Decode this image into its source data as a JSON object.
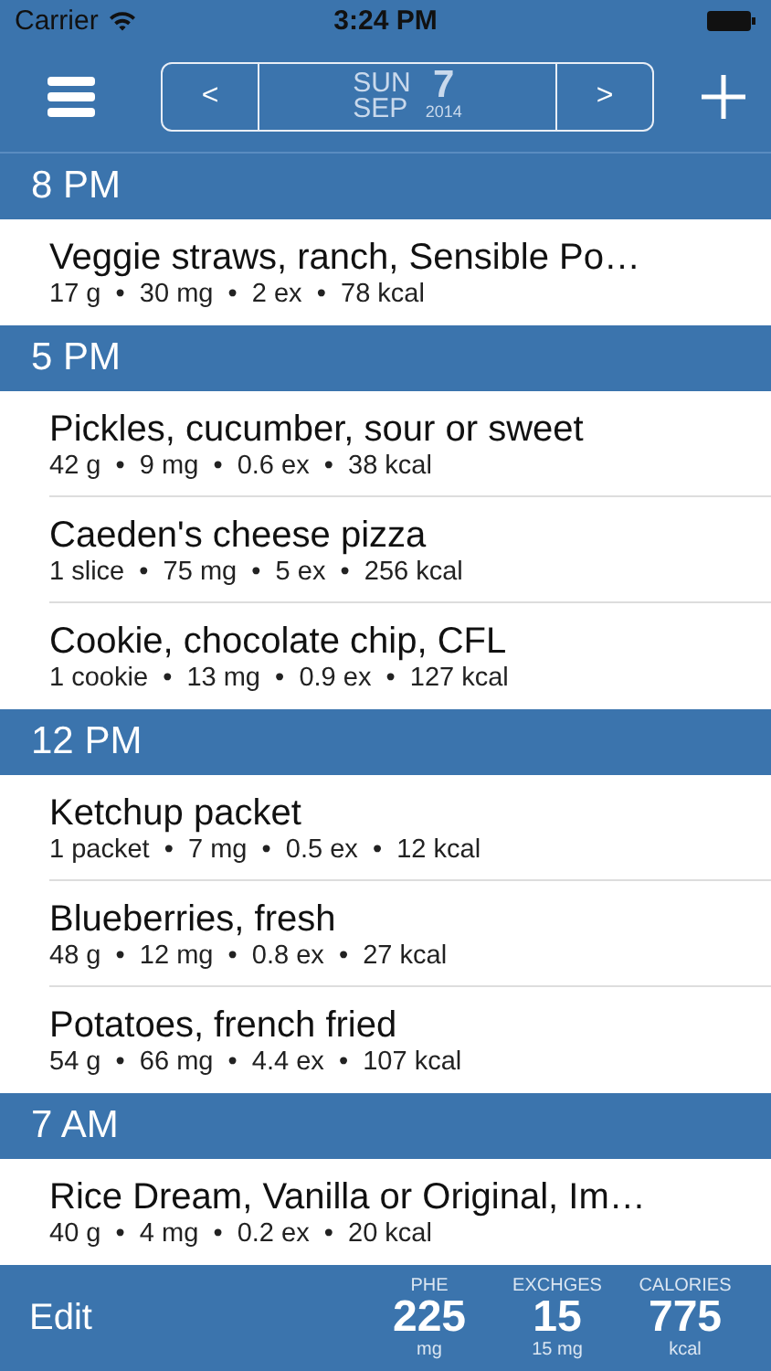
{
  "status_bar": {
    "carrier": "Carrier",
    "time": "3:24 PM"
  },
  "nav": {
    "prev": "<",
    "next": ">",
    "weekday": "SUN",
    "month": "SEP",
    "day": "7",
    "year": "2014"
  },
  "sections": [
    {
      "time": "8 PM",
      "items": [
        {
          "name": "Veggie straws, ranch, Sensible Po…",
          "details": "17 g  •  30 mg  •  2 ex  •  78 kcal"
        }
      ]
    },
    {
      "time": "5 PM",
      "items": [
        {
          "name": "Pickles, cucumber, sour or sweet",
          "details": "42 g  •  9 mg  •  0.6 ex  •  38 kcal"
        },
        {
          "name": "Caeden's cheese pizza",
          "details": "1 slice  •  75 mg  •  5 ex  •  256 kcal"
        },
        {
          "name": "Cookie, chocolate chip, CFL",
          "details": "1 cookie  •  13 mg  •  0.9 ex  •  127 kcal"
        }
      ]
    },
    {
      "time": "12 PM",
      "items": [
        {
          "name": "Ketchup packet",
          "details": "1 packet  •  7 mg  •  0.5 ex  •  12 kcal"
        },
        {
          "name": "Blueberries, fresh",
          "details": "48 g  •  12 mg  •  0.8 ex  •  27 kcal"
        },
        {
          "name": "Potatoes, french fried",
          "details": "54 g  •  66 mg  •  4.4 ex  •  107 kcal"
        }
      ]
    },
    {
      "time": "7 AM",
      "items": [
        {
          "name": "Rice Dream, Vanilla or Original, Im…",
          "details": "40 g  •  4 mg  •  0.2 ex  •  20 kcal"
        }
      ]
    }
  ],
  "toolbar": {
    "edit": "Edit",
    "totals": [
      {
        "label": "PHE",
        "value": "225",
        "unit": "mg"
      },
      {
        "label": "EXCHGES",
        "value": "15",
        "unit": "15 mg"
      },
      {
        "label": "CALORIES",
        "value": "775",
        "unit": "kcal"
      }
    ]
  }
}
